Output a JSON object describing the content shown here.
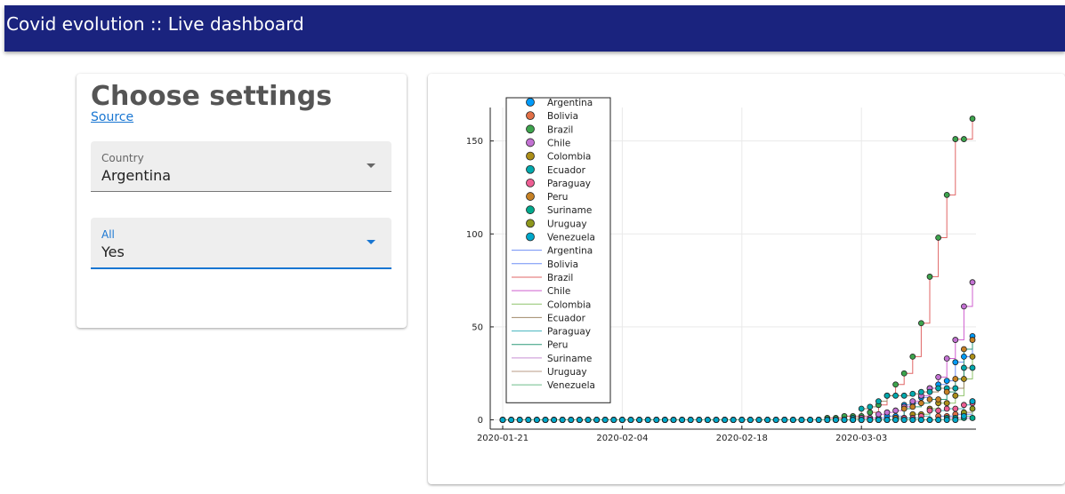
{
  "header": {
    "title": "Covid evolution :: Live dashboard"
  },
  "settings": {
    "heading": "Choose settings",
    "source_link": "Source",
    "country": {
      "label": "Country",
      "value": "Argentina"
    },
    "all": {
      "label": "All",
      "value": "Yes"
    }
  },
  "colors": {
    "header_bg": "#1a237e",
    "accent": "#1976d2"
  },
  "chart_data": {
    "type": "line",
    "title": "",
    "xlabel": "",
    "ylabel": "",
    "x_tick_labels": [
      "2020-01-21",
      "2020-02-04",
      "2020-02-18",
      "2020-03-03"
    ],
    "y_ticks": [
      0,
      50,
      100,
      150
    ],
    "grid": true,
    "legend_position": "top-left",
    "x_start": "2020-01-21",
    "x_end": "2020-03-16",
    "ylim": [
      -5,
      168
    ],
    "series": [
      {
        "name": "Argentina",
        "color": "#009af9",
        "line_color": "#6f8ff5",
        "values": [
          1,
          2,
          2,
          8,
          9,
          12,
          17,
          19,
          21,
          31,
          34,
          45
        ]
      },
      {
        "name": "Bolivia",
        "color": "#e26f46",
        "line_color": "#6f8ff5",
        "values": [
          0,
          0,
          0,
          0,
          0,
          0,
          0,
          2,
          2,
          3,
          3,
          10
        ]
      },
      {
        "name": "Brazil",
        "color": "#3da44d",
        "line_color": "#e06666",
        "values": [
          1,
          1,
          2,
          2,
          2,
          4,
          8,
          13,
          19,
          25,
          34,
          52,
          77,
          98,
          121,
          151,
          151,
          162
        ]
      },
      {
        "name": "Chile",
        "color": "#c271d2",
        "line_color": "#cf5fcf",
        "values": [
          1,
          1,
          3,
          4,
          5,
          7,
          10,
          13,
          17,
          23,
          33,
          43,
          61,
          74
        ]
      },
      {
        "name": "Colombia",
        "color": "#ac8e18",
        "line_color": "#8fc36b",
        "values": [
          1,
          1,
          3,
          3,
          6,
          9,
          9,
          13,
          22,
          34
        ]
      },
      {
        "name": "Ecuador",
        "color": "#00a9ad",
        "line_color": "#a08a68",
        "values": [
          1,
          6,
          7,
          10,
          13,
          13,
          13,
          14,
          15,
          15,
          17,
          17,
          17,
          28,
          28
        ]
      },
      {
        "name": "Paraguay",
        "color": "#ed5e93",
        "line_color": "#4db8c1",
        "values": [
          1,
          1,
          2,
          5,
          5,
          6,
          6,
          8,
          9
        ]
      },
      {
        "name": "Peru",
        "color": "#c68125",
        "line_color": "#2d9a79",
        "values": [
          1,
          6,
          7,
          9,
          11,
          11,
          15,
          22,
          38,
          43
        ]
      },
      {
        "name": "Suriname",
        "color": "#00a98d",
        "line_color": "#c78fd3",
        "values": [
          0,
          0,
          0,
          0,
          0,
          0,
          1,
          1,
          1,
          1
        ]
      },
      {
        "name": "Uruguay",
        "color": "#8e971d",
        "line_color": "#b99b85",
        "values": [
          0,
          0,
          0,
          0,
          0,
          0,
          0,
          4,
          6
        ]
      },
      {
        "name": "Venezuela",
        "color": "#00a8cb",
        "line_color": "#6ebc8a",
        "values": [
          0,
          0,
          0,
          0,
          0,
          0,
          0,
          2,
          10
        ]
      }
    ]
  }
}
